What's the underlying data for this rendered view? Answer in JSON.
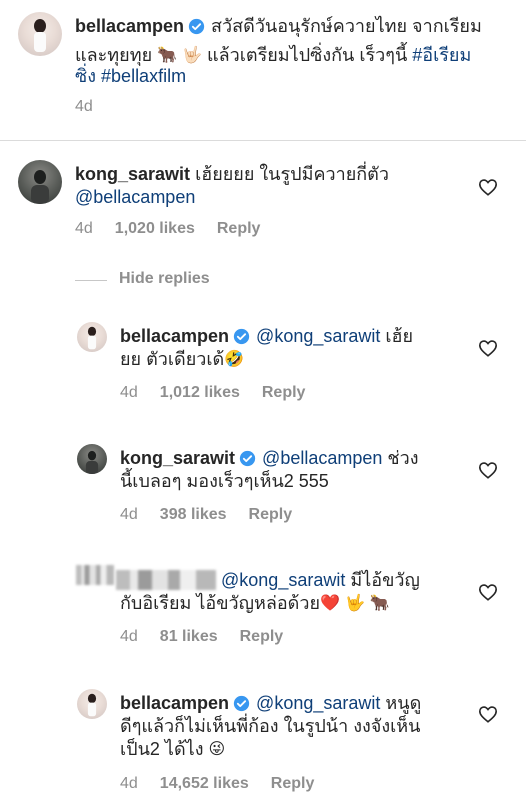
{
  "post": {
    "username": "bellacampen",
    "caption_l1_text": "สวัสดีวันอนุรักษ์ควายไทย จากเรียม",
    "caption_l2_text": "และทุยทุย",
    "caption_l2_emoji1": "🐂",
    "caption_l2_emoji2": "🤟🏻",
    "caption_l2_tail": "แล้วเตรียมไปซิ่งกัน เร็วๆนี้",
    "caption_hashtag1_a": "#อีเรียม",
    "caption_hashtag1_b": "ซิ่ง",
    "caption_hashtag2": "#bellaxfilm",
    "time": "4d"
  },
  "comments": [
    {
      "username": "kong_sarawit",
      "text_l1": "เฮ้ยยยย ในรูปมีควายกี่ตัว",
      "mention_l2": "@bellacampen",
      "time": "4d",
      "likes": "1,020 likes",
      "reply": "Reply"
    }
  ],
  "hide_replies": "Hide replies",
  "replies": [
    {
      "username": "bellacampen",
      "mention": "@kong_sarawit",
      "text_l1_tail": "เฮ้ย",
      "text_l2": "ยย ตัวเดียวเด้",
      "emoji": "🤣",
      "time": "4d",
      "likes": "1,012 likes",
      "reply": "Reply"
    },
    {
      "username": "kong_sarawit",
      "mention": "@bellacampen",
      "text_l1_tail": "ช่วง",
      "text_l2": "นี้เบลอๆ มองเร็วๆเห็น2 555",
      "time": "4d",
      "likes": "398 likes",
      "reply": "Reply"
    },
    {
      "mention": "@kong_sarawit",
      "text_l1_tail": "มีไอ้ขวัญ",
      "text_l2": "กับอิเรียม ไอ้ขวัญหล่อด้วย",
      "emoji1": "❤️",
      "emoji2": "🤟",
      "emoji3": "🐂",
      "time": "4d",
      "likes": "81 likes",
      "reply": "Reply"
    },
    {
      "username": "bellacampen",
      "mention": "@kong_sarawit",
      "text_l1_tail": "หนูดู",
      "text_l2": "ดีๆแล้วก็ไม่เห็นพี่ก้อง ในรูปน้า งงจังเห็น",
      "text_l3": "เป็น2 ได้ไง",
      "emoji": "😜",
      "time": "4d",
      "likes": "14,652 likes",
      "reply": "Reply"
    }
  ],
  "colors": {
    "text": "#262626",
    "muted": "#8e8e8e",
    "link": "#0f3f78",
    "verified": "#3897f0"
  }
}
